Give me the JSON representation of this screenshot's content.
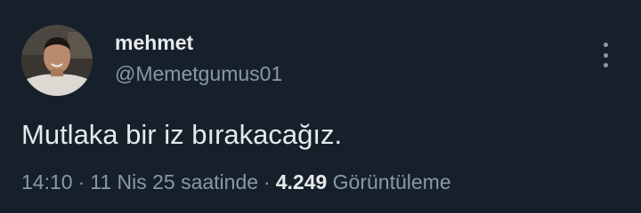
{
  "tweet": {
    "author": {
      "display_name": "mehmet",
      "handle": "@Memetgumus01",
      "avatar_icon": "profile-photo"
    },
    "more_icon": "vertical-ellipsis-icon",
    "text": "Mutlaka bir iz bırakacağız.",
    "meta": {
      "time": "14:10",
      "separator": "·",
      "date": "11 Nis 25 saatinde",
      "views_count": "4.249",
      "views_label": "Görüntüleme"
    },
    "colors": {
      "background": "#15202b",
      "primary_text": "#e7e9ea",
      "secondary_text": "#8b98a5"
    }
  }
}
